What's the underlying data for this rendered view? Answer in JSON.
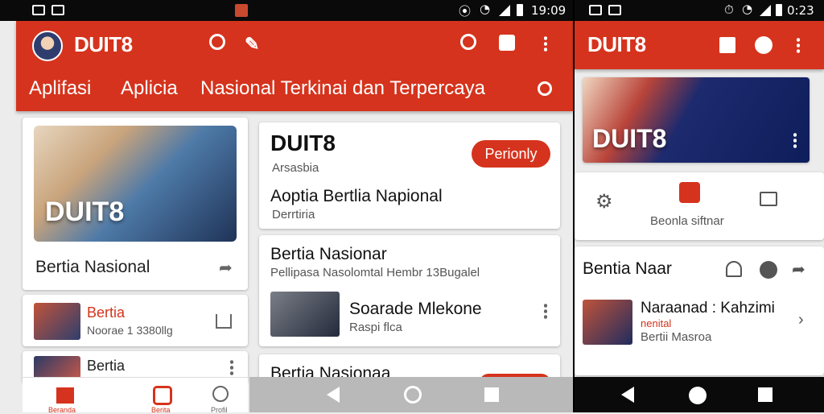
{
  "left_status": {
    "time": "19:09"
  },
  "right_status": {
    "time": "0:23"
  },
  "left_app": {
    "brand": "DUIT8",
    "tabs": [
      "Aplifasi",
      "Aplicia",
      "Nasional Terkinai dan Terpercaya"
    ],
    "hero_card": {
      "image_label": "DUIT8",
      "title": "Bertia Nasional"
    },
    "list_items": [
      {
        "title": "Bertia",
        "subtitle": "Noorae 1 3380llg"
      },
      {
        "title": "Bertia",
        "subtitle": ""
      }
    ],
    "feature_card": {
      "title": "DUIT8",
      "subtitle": "Arsasbia",
      "pill": "Perionly",
      "headline": "Aoptia Bertlia Napional",
      "tag": "Derrtiria"
    },
    "article_card": {
      "title": "Bertia Nasionar",
      "subtitle": "Pellipasa Nasolomtal Hembr 13Bugalel",
      "item_title": "Soarade Mlekone",
      "item_sub": "Raspi flca"
    },
    "article_card_2": {
      "title": "Bertia Nasionaa"
    },
    "bottom_nav": [
      "Beranda",
      "Berita",
      "Profil"
    ]
  },
  "right_app": {
    "brand": "DUIT8",
    "hero": {
      "label": "DUIT8"
    },
    "shortcut_label": "Beonla siftnar",
    "section_title": "Bentia Naar",
    "item": {
      "title": "Naraanad : Kahzimi",
      "line2": "nenital",
      "line3": "Bertii Masroa"
    }
  },
  "colors": {
    "accent": "#d5331d",
    "status": "#0a0a0a"
  }
}
